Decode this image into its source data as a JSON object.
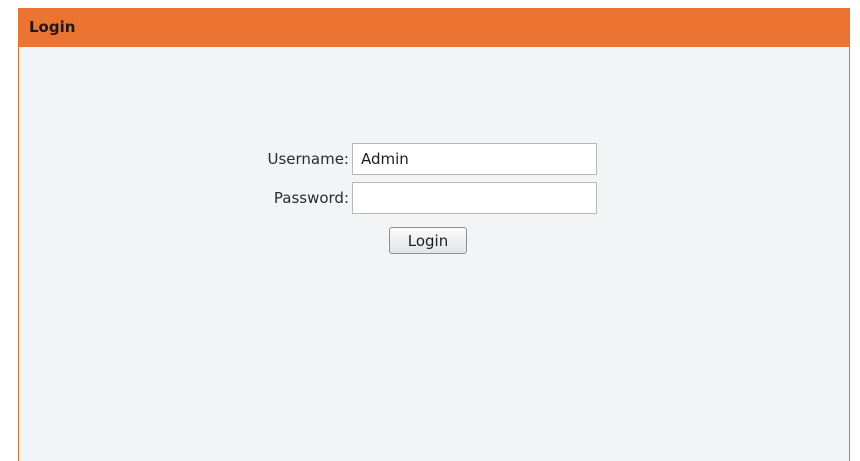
{
  "panel": {
    "title": "Login"
  },
  "form": {
    "username_label": "Username:",
    "username_value": "Admin",
    "password_label": "Password:",
    "password_value": "",
    "login_button_label": "Login"
  },
  "colors": {
    "header_background": "#ec7431",
    "panel_background": "#f3f4f6"
  }
}
